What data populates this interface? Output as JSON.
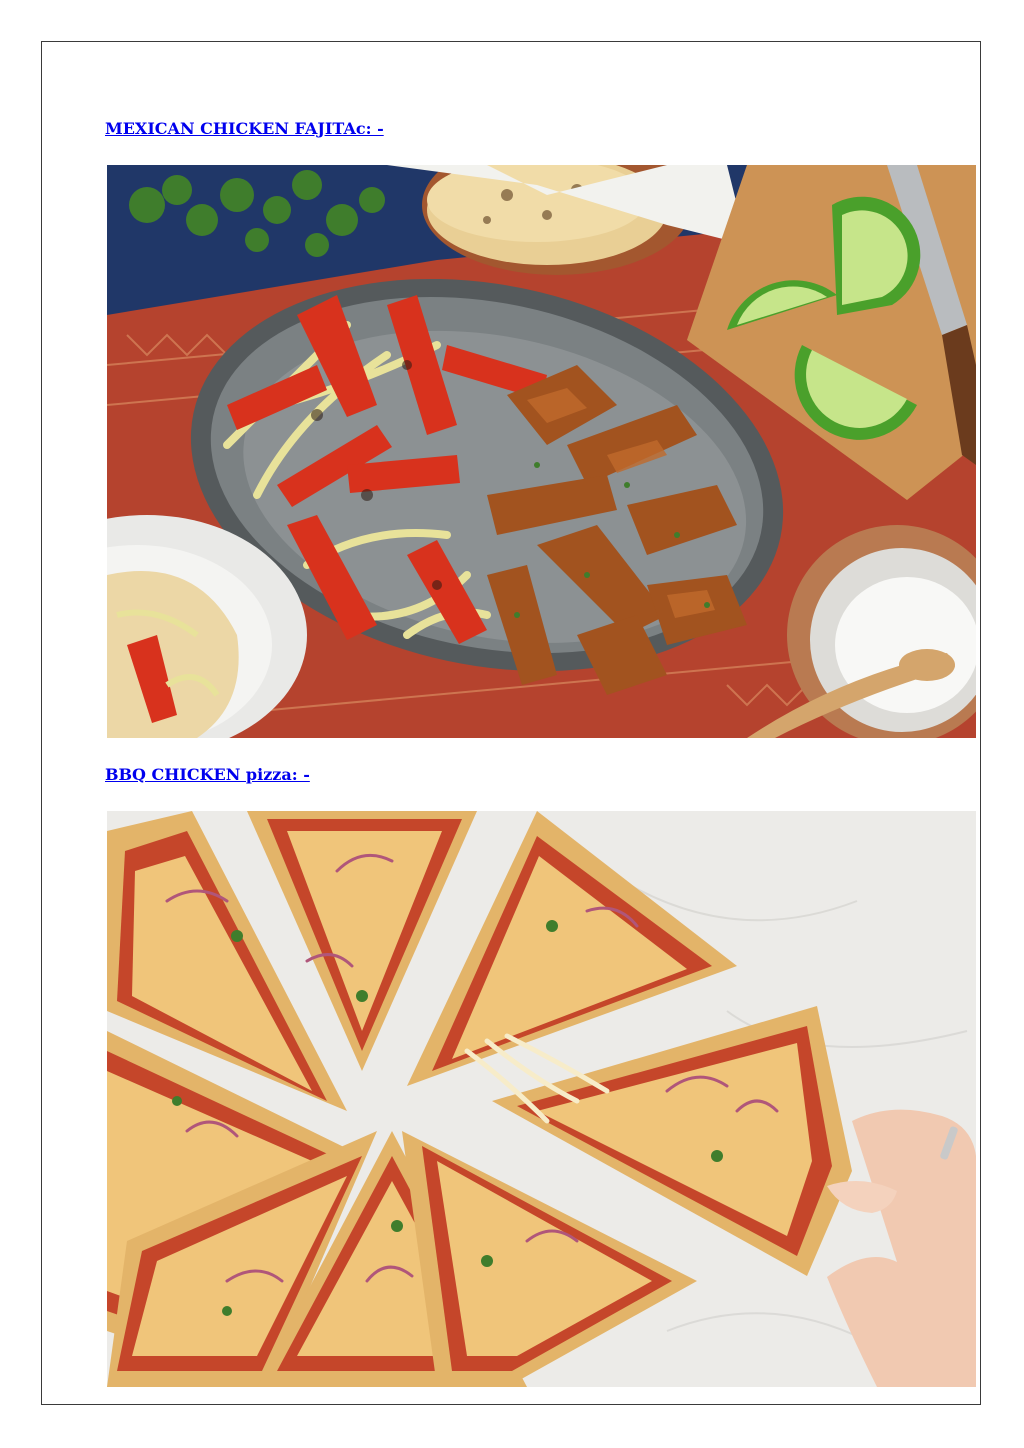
{
  "headings": {
    "fajitas": "MEXICAN CHICKEN FAJITAc: -",
    "pizza": "BBQ CHICKEN pizza: -"
  },
  "colors": {
    "link": "#0000ee",
    "frame": "#3a3a3a"
  }
}
